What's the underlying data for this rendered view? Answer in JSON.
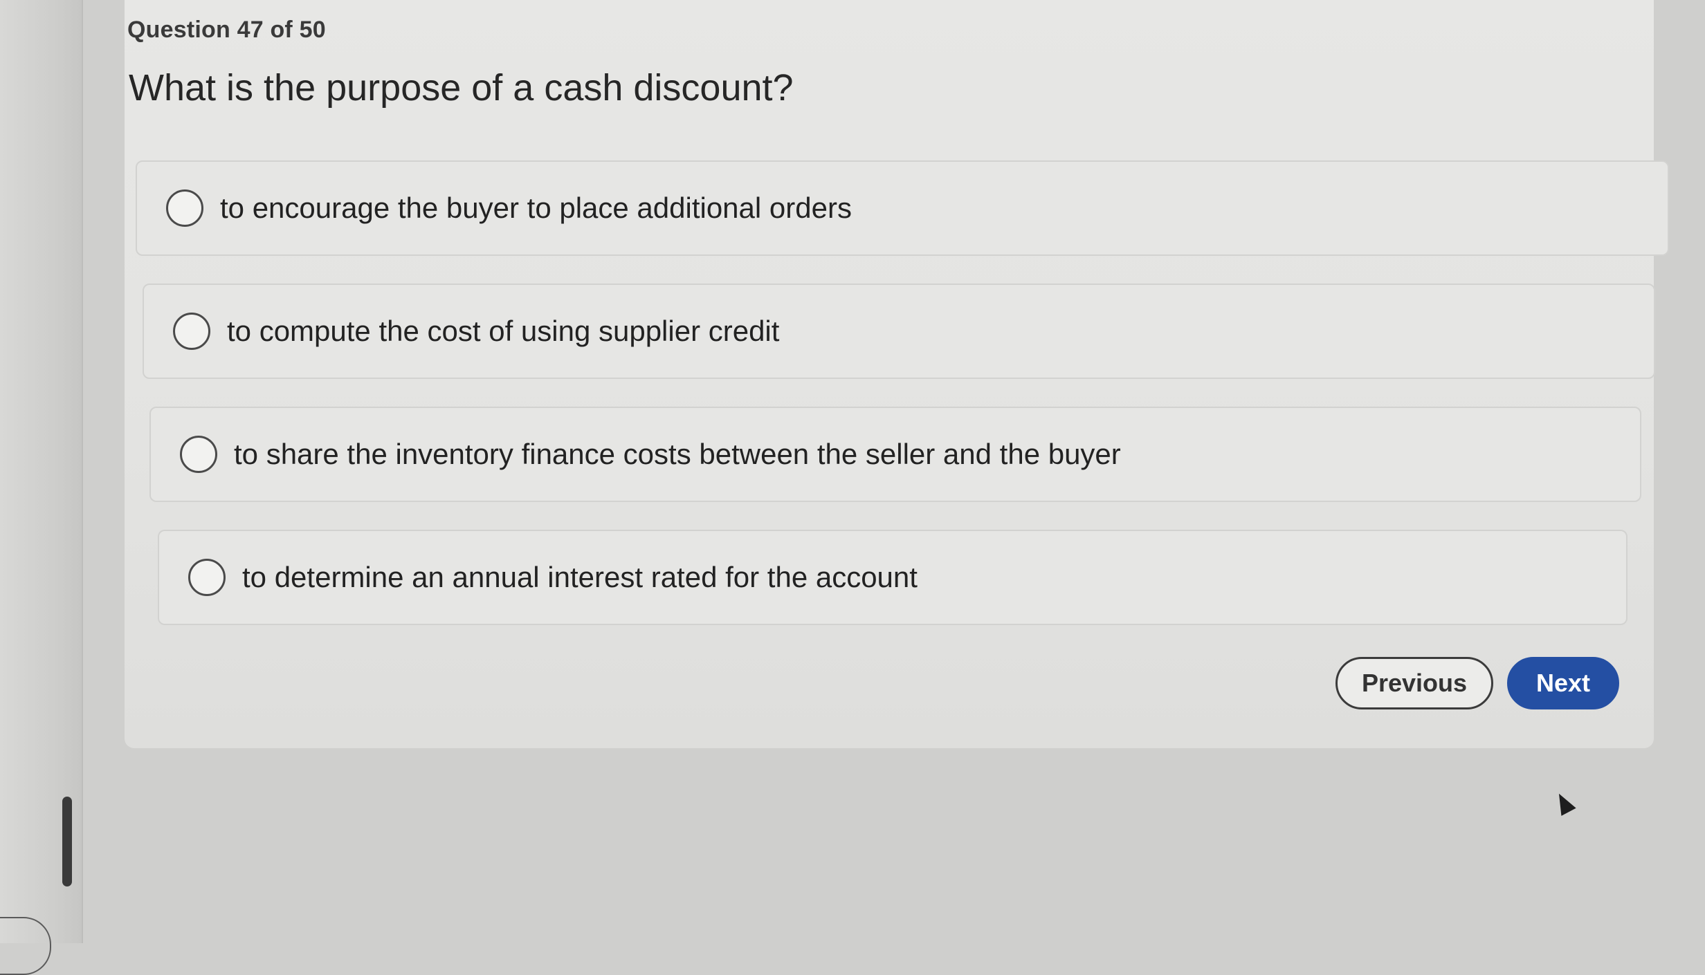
{
  "quiz": {
    "counter": "Question 47 of 50",
    "question": "What is the purpose of a cash discount?",
    "options": [
      {
        "label": "to encourage the buyer to place additional orders"
      },
      {
        "label": "to compute the cost of using supplier credit"
      },
      {
        "label": "to share the inventory finance costs between the seller and the buyer"
      },
      {
        "label": "to determine an annual interest rated for the account"
      }
    ],
    "selected_option": null
  },
  "navigation": {
    "previous_label": "Previous",
    "next_label": "Next"
  },
  "colors": {
    "next_button": "#244fa3",
    "page_background": "#cfcfcd",
    "card_background": "#e6e6e4"
  },
  "icons": {
    "radio": "radio-unchecked-icon",
    "cursor": "mouse-pointer-icon"
  }
}
